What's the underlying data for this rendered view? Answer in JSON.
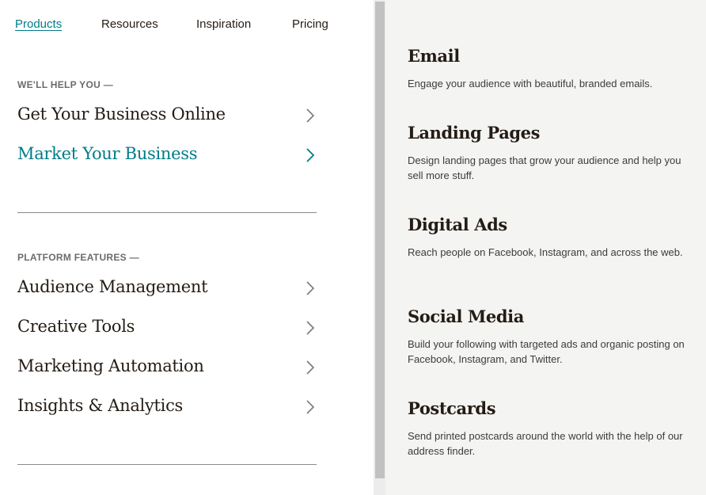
{
  "top_nav": {
    "items": [
      {
        "label": "Products",
        "active": true
      },
      {
        "label": "Resources",
        "active": false
      },
      {
        "label": "Inspiration",
        "active": false
      },
      {
        "label": "Pricing",
        "active": false
      }
    ]
  },
  "help_section": {
    "label": "WE'LL HELP YOU —",
    "items": [
      {
        "label": "Get Your Business Online",
        "icon": "chevron-right-icon"
      },
      {
        "label": "Market Your Business",
        "icon": "chevron-right-icon",
        "active": true
      }
    ]
  },
  "platform_section": {
    "label": "PLATFORM FEATURES —",
    "items": [
      {
        "label": "Audience Management",
        "icon": "chevron-right-icon"
      },
      {
        "label": "Creative Tools",
        "icon": "chevron-right-icon"
      },
      {
        "label": "Marketing Automation",
        "icon": "chevron-right-icon"
      },
      {
        "label": "Insights & Analytics",
        "icon": "chevron-right-icon"
      }
    ]
  },
  "products": [
    {
      "title": "Email",
      "description": "Engage your audience with beautiful, branded emails."
    },
    {
      "title": "Landing Pages",
      "description": "Design landing pages that grow your audience and help you sell more stuff."
    },
    {
      "title": "Digital Ads",
      "description": "Reach people on Facebook, Instagram, and across the web."
    },
    {
      "title": "Social Media",
      "description": "Build your following with targeted ads and organic posting on Facebook, Instagram, and Twitter."
    },
    {
      "title": "Postcards",
      "description": "Send printed postcards around the world with the help of our address finder."
    }
  ],
  "colors": {
    "accent": "#007c89",
    "text": "#241c15",
    "panel_bg": "#f4f4f2"
  }
}
